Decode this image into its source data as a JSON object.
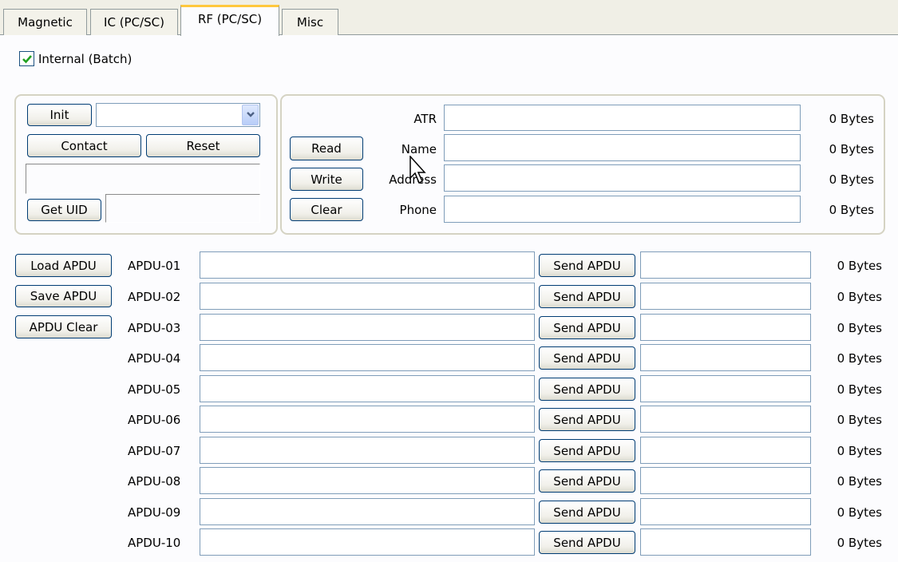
{
  "tabs": [
    {
      "label": "Magnetic",
      "active": false
    },
    {
      "label": "IC (PC/SC)",
      "active": false
    },
    {
      "label": "RF (PC/SC)",
      "active": true
    },
    {
      "label": "Misc",
      "active": false
    }
  ],
  "internal_batch": {
    "label": "Internal (Batch)",
    "checked": true
  },
  "reader_panel": {
    "init_label": "Init",
    "reader_select_value": "",
    "contact_label": "Contact",
    "reset_label": "Reset",
    "status_value": "",
    "get_uid_label": "Get UID",
    "uid_value": ""
  },
  "card_panel": {
    "read_label": "Read",
    "write_label": "Write",
    "clear_label": "Clear",
    "fields": [
      {
        "label": "ATR",
        "value": "",
        "size": "0 Bytes"
      },
      {
        "label": "Name",
        "value": "",
        "size": "0 Bytes"
      },
      {
        "label": "Address",
        "value": "",
        "size": "0 Bytes"
      },
      {
        "label": "Phone",
        "value": "",
        "size": "0 Bytes"
      }
    ]
  },
  "apdu_actions": {
    "load_label": "Load APDU",
    "save_label": "Save APDU",
    "clear_label": "APDU Clear"
  },
  "apdu_rows": [
    {
      "label": "APDU-01",
      "command": "",
      "send_label": "Send APDU",
      "response": "",
      "size": "0 Bytes"
    },
    {
      "label": "APDU-02",
      "command": "",
      "send_label": "Send APDU",
      "response": "",
      "size": "0 Bytes"
    },
    {
      "label": "APDU-03",
      "command": "",
      "send_label": "Send APDU",
      "response": "",
      "size": "0 Bytes"
    },
    {
      "label": "APDU-04",
      "command": "",
      "send_label": "Send APDU",
      "response": "",
      "size": "0 Bytes"
    },
    {
      "label": "APDU-05",
      "command": "",
      "send_label": "Send APDU",
      "response": "",
      "size": "0 Bytes"
    },
    {
      "label": "APDU-06",
      "command": "",
      "send_label": "Send APDU",
      "response": "",
      "size": "0 Bytes"
    },
    {
      "label": "APDU-07",
      "command": "",
      "send_label": "Send APDU",
      "response": "",
      "size": "0 Bytes"
    },
    {
      "label": "APDU-08",
      "command": "",
      "send_label": "Send APDU",
      "response": "",
      "size": "0 Bytes"
    },
    {
      "label": "APDU-09",
      "command": "",
      "send_label": "Send APDU",
      "response": "",
      "size": "0 Bytes"
    },
    {
      "label": "APDU-10",
      "command": "",
      "send_label": "Send APDU",
      "response": "",
      "size": "0 Bytes"
    }
  ],
  "colors": {
    "tab_highlight": "#ffc83c",
    "button_border": "#003c74",
    "field_border": "#7f9db9",
    "checkmark": "#21a121"
  },
  "icons": [
    "checkmark-icon",
    "chevron-down-icon",
    "mouse-cursor-icon"
  ]
}
